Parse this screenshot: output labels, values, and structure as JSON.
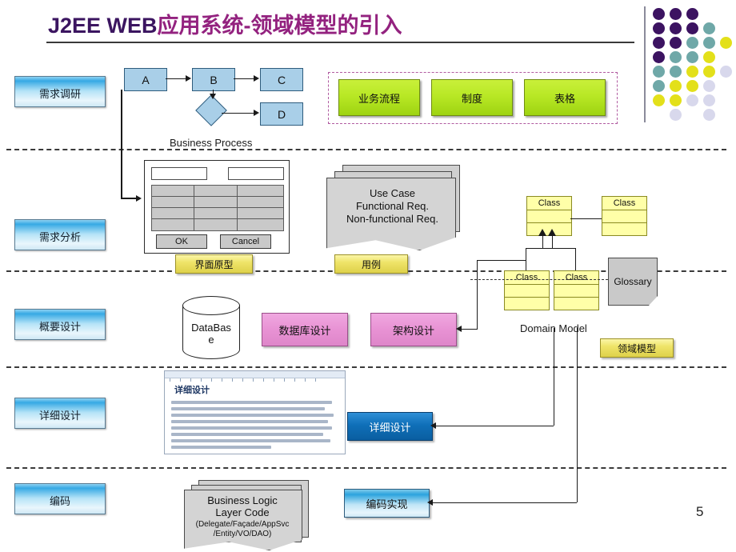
{
  "slide": {
    "title_en": "J2EE WEB",
    "title_cn": "应用系统-领域模型的引入",
    "page_number": "5"
  },
  "colors": {
    "title": "#93227f",
    "phase_chip": "#36a9e4",
    "green_box": "#b8e825",
    "yellow_tag": "#efe469",
    "pink_box": "#e892d4",
    "class_box": "#ffffa8",
    "dark_blue": "#0f6fb8",
    "panel_border": "#b05aa0",
    "dot_purple": "#3c1361",
    "dot_teal": "#6fa8a8",
    "dot_yellow": "#e3e01a",
    "dot_lavender": "#d8d8ec"
  },
  "phases": [
    {
      "label": "需求调研"
    },
    {
      "label": "需求分析"
    },
    {
      "label": "概要设计"
    },
    {
      "label": "详细设计"
    },
    {
      "label": "编码"
    }
  ],
  "business_process": {
    "caption": "Business Process",
    "nodes": [
      {
        "id": "A",
        "label": "A"
      },
      {
        "id": "B",
        "label": "B"
      },
      {
        "id": "C",
        "label": "C"
      },
      {
        "id": "D",
        "label": "D"
      }
    ]
  },
  "inputs_panel": {
    "boxes": [
      {
        "label": "业务流程"
      },
      {
        "label": "制度"
      },
      {
        "label": "表格"
      }
    ]
  },
  "ui_mockup": {
    "ok_label": "OK",
    "cancel_label": "Cancel",
    "tag": "界面原型"
  },
  "use_case": {
    "lines": [
      "Use Case",
      "Functional Req.",
      "Non-functional Req."
    ],
    "tag": "用例"
  },
  "domain_model": {
    "caption": "Domain Model",
    "class_label": "Class",
    "classes": [
      {
        "label": "Class"
      },
      {
        "label": "Class"
      },
      {
        "label": "Class"
      },
      {
        "label": "Class"
      }
    ],
    "glossary": "Glossary",
    "tag": "领域模型"
  },
  "database": {
    "label_line1": "DataBas",
    "label_line2": "e"
  },
  "design_boxes": {
    "db_design": "数据库设计",
    "arch_design": "架构设计",
    "detail_design": "详细设计",
    "code_impl": "编码实现"
  },
  "word_doc": {
    "heading": "详细设计"
  },
  "code_stack": {
    "lines": [
      "Business Logic",
      "Layer Code",
      "(Delegate/Façade/AppSvc",
      "/Entity/VO/DAO)"
    ]
  },
  "dot_grid": {
    "rows": [
      [
        "purple",
        "purple",
        "purple",
        "none",
        "none"
      ],
      [
        "purple",
        "purple",
        "purple",
        "teal",
        "none"
      ],
      [
        "purple",
        "purple",
        "teal",
        "teal",
        "yellow"
      ],
      [
        "purple",
        "teal",
        "teal",
        "yellow",
        "none"
      ],
      [
        "teal",
        "teal",
        "yellow",
        "yellow",
        "lav"
      ],
      [
        "teal",
        "yellow",
        "yellow",
        "lav",
        "none"
      ],
      [
        "yellow",
        "yellow",
        "lav",
        "lav",
        "none"
      ],
      [
        "none",
        "lav",
        "none",
        "lav",
        "none"
      ]
    ]
  }
}
